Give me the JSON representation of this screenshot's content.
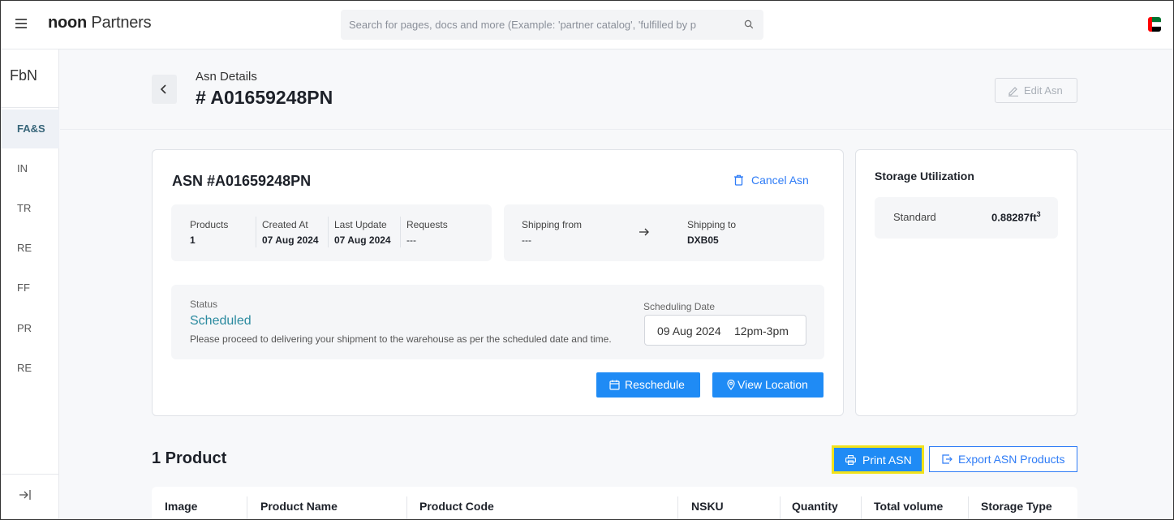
{
  "topbar": {
    "brand_bold": "noon",
    "brand_rest": " Partners",
    "search_placeholder": "Search for pages, docs and more (Example: 'partner catalog', 'fulfilled by p",
    "icons": [
      "hamburger-icon",
      "search-icon",
      "uae-flag-icon"
    ]
  },
  "sidebar": {
    "header": "FbN",
    "items": [
      {
        "label": "FA&S",
        "active": true
      },
      {
        "label": "IN",
        "active": false
      },
      {
        "label": "TR",
        "active": false
      },
      {
        "label": "RE",
        "active": false
      },
      {
        "label": "FF",
        "active": false
      },
      {
        "label": "PR",
        "active": false
      },
      {
        "label": "RE",
        "active": false
      }
    ],
    "collapse_icon": "collapse-right-icon"
  },
  "header": {
    "subtitle": "Asn Details",
    "title": "# A01659248PN",
    "edit_label": "Edit Asn"
  },
  "asn": {
    "title": "ASN #A01659248PN",
    "cancel_label": "Cancel Asn",
    "summary": [
      {
        "label": "Products",
        "value": "1"
      },
      {
        "label": "Created At",
        "value": "07 Aug 2024"
      },
      {
        "label": "Last Update",
        "value": "07 Aug 2024"
      },
      {
        "label": "Requests",
        "value": "---"
      }
    ],
    "shipping": {
      "from_label": "Shipping from",
      "from_value": "---",
      "to_label": "Shipping to",
      "to_value": "DXB05"
    },
    "status": {
      "label": "Status",
      "value": "Scheduled",
      "description": "Please proceed to delivering your shipment to the warehouse as per the scheduled date and time.",
      "color": "#2b8a9f"
    },
    "scheduling": {
      "label": "Scheduling Date",
      "date": "09 Aug 2024",
      "time": "12pm-3pm"
    },
    "reschedule_label": "Reschedule",
    "view_location_label": "View Location"
  },
  "storage": {
    "title": "Storage Utilization",
    "label": "Standard",
    "value": "0.88287ft",
    "unit_sup": "3"
  },
  "products": {
    "title": "1 Product",
    "print_label": "Print ASN",
    "export_label": "Export ASN Products",
    "columns": [
      "Image",
      "Product Name",
      "Product Code",
      "NSKU",
      "Quantity",
      "Total volume",
      "Storage Type"
    ]
  },
  "colors": {
    "accent": "#1f8bf5",
    "highlight_border": "#f1e21b",
    "link": "#2f7cf6"
  }
}
